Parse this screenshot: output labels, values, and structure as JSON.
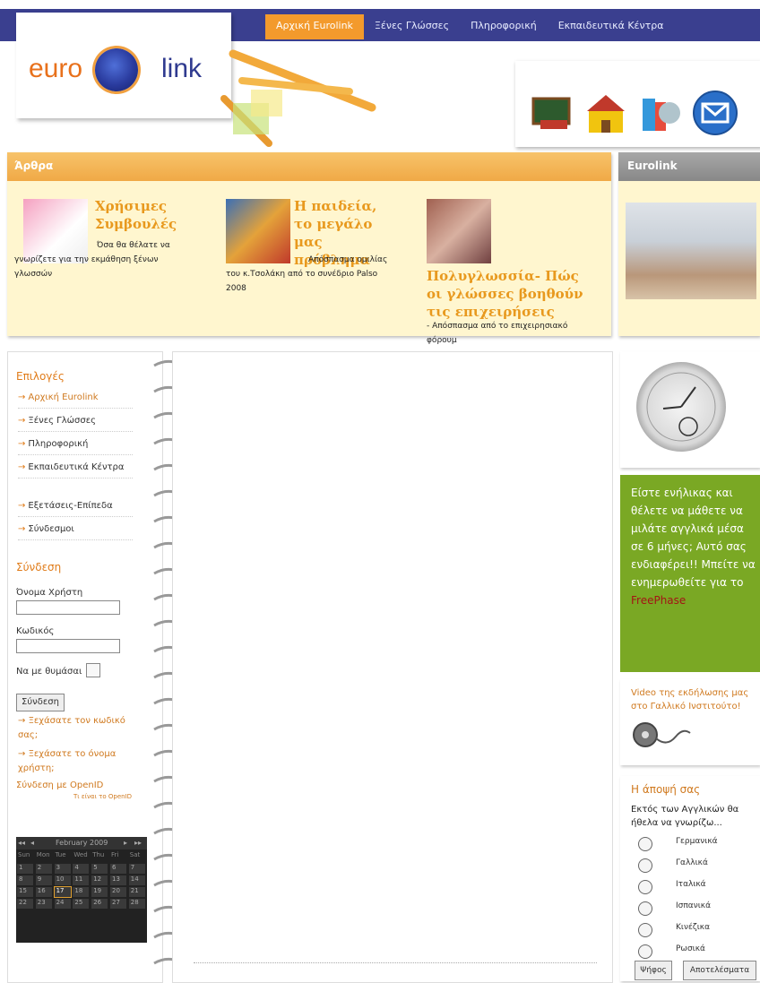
{
  "nav": {
    "items": [
      "Αρχική Eurolink",
      "Ξένες Γλώσσες",
      "Πληροφορική",
      "Εκπαιδευτικά Κέντρα"
    ],
    "active_index": 0
  },
  "logo": {
    "part1": "euro",
    "part2": "link"
  },
  "articles": {
    "title": "Άρθρα",
    "items": [
      {
        "title": "Χρήσιμες Συμβουλές",
        "text": "Όσα θα θέλατε να γνωρίζετε για την εκμάθηση ξένων γλωσσών"
      },
      {
        "title": "Η παιδεία, το μεγάλο μας πρόβλημα",
        "text": "Απόσπασμα ομιλίας του κ.Τσολάκη από το συνέδριο Palso 2008"
      },
      {
        "title": "Πολυγλωσσία- Πώς οι γλώσσες βοηθούν τις επιχειρήσεις",
        "text": "- Απόσπασμα από το επιχειρησιακό φόρουμ"
      }
    ]
  },
  "eurolink_box": {
    "title": "Eurolink"
  },
  "sidebar": {
    "options_title": "Επιλογές",
    "menu": [
      "Αρχική Eurolink",
      "Ξένες Γλώσσες",
      "Πληροφορική",
      "Εκπαιδευτικά Κέντρα"
    ],
    "menu2": [
      "Εξετάσεις-Επίπεδα",
      "Σύνδεσμοι"
    ],
    "login_title": "Σύνδεση",
    "username_label": "Όνομα Χρήστη",
    "password_label": "Κωδικός",
    "remember_label": "Να με θυμάσαι",
    "login_button": "Σύνδεση",
    "forgot_password": "Ξεχάσατε τον κωδικό σας;",
    "forgot_username": "Ξεχάσατε το όνομα χρήστη;",
    "openid": "Σύνδεση με OpenID",
    "openid_small": "Τι είναι το OpenID"
  },
  "calendar": {
    "month": "February 2009",
    "weekdays": [
      "Sun",
      "Mon",
      "Tue",
      "Wed",
      "Thu",
      "Fri",
      "Sat"
    ],
    "days": [
      1,
      2,
      3,
      4,
      5,
      6,
      7,
      8,
      9,
      10,
      11,
      12,
      13,
      14,
      15,
      16,
      17,
      18,
      19,
      20,
      21,
      22,
      23,
      24,
      25,
      26,
      27,
      28
    ],
    "today": 17,
    "nav_prev_year": "◂◂",
    "nav_prev": "◂",
    "nav_next": "▸",
    "nav_next_year": "▸▸"
  },
  "green_box": {
    "text": "Είστε ενήλικας και θέλετε να μάθετε να μιλάτε αγγλικά μέσα σε 6 μήνες; Αυτό σας ενδιαφέρει!! Μπείτε να ενημερωθείτε για το",
    "link": "FreePhase"
  },
  "video_box": {
    "text": "Video της εκδήλωσης μας στο Γαλλικό Ινστιτούτο!"
  },
  "poll": {
    "title": "Η άποψή σας",
    "question": "Εκτός των Αγγλικών θα ήθελα να γνωρίζω...",
    "options": [
      "Γερμανικά",
      "Γαλλικά",
      "Ιταλικά",
      "Ισπανικά",
      "Κινέζικα",
      "Ρωσικά"
    ],
    "vote_button": "Ψήφος",
    "results_button": "Αποτελέσματα"
  },
  "colors": {
    "nav_bg": "#3a3f8f",
    "active_tab": "#f39a2c",
    "accent": "#e07c1a",
    "green": "#7aa824"
  }
}
